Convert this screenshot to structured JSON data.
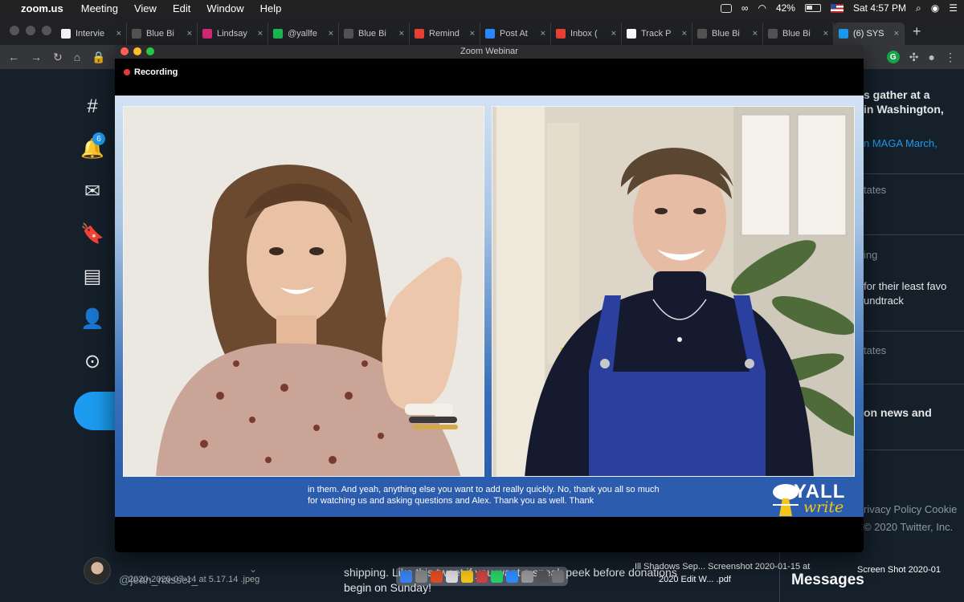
{
  "menubar": {
    "app": "zoom.us",
    "items": [
      "Meeting",
      "View",
      "Edit",
      "Window",
      "Help"
    ],
    "battery": "42%",
    "clock": "Sat 4:57 PM"
  },
  "browser": {
    "tabs": [
      {
        "label": "Intervie",
        "color": "#f2f2f2"
      },
      {
        "label": "Blue Bi",
        "color": "#555555"
      },
      {
        "label": "Lindsay",
        "color": "#d62976"
      },
      {
        "label": "@yallfe",
        "color": "#1db954"
      },
      {
        "label": "Blue Bi",
        "color": "#555555"
      },
      {
        "label": "Remind",
        "color": "#ea4335"
      },
      {
        "label": "Post At",
        "color": "#2d8cff"
      },
      {
        "label": "Inbox (",
        "color": "#ea4335"
      },
      {
        "label": "Track P",
        "color": "#ffffff"
      },
      {
        "label": "Blue Bi",
        "color": "#555555"
      },
      {
        "label": "Blue Bi",
        "color": "#555555"
      },
      {
        "label": "(6) SYS",
        "color": "#1d9bf0"
      }
    ]
  },
  "twitter": {
    "notification_count": "6",
    "right": {
      "line1": "s gather at a",
      "line2": "in Washington,",
      "line3": "n MAGA March,",
      "line4": "tates",
      "line5": "ing",
      "line6": "for their least favo",
      "line7": "undtrack",
      "line8": "tates",
      "line9": "on news and",
      "footer1": "rivacy Policy  Cookie",
      "footer2": "© 2020 Twitter, Inc."
    },
    "handle": "@jean_nasser_",
    "tweet_line1": "shipping. Like this tweet if you want a sneak peek before donations",
    "tweet_line2": "begin on Sunday!",
    "messages_title": "Messages"
  },
  "desktop": {
    "file1": "Ill Shadows Sep... Screenshot 2020-01-15 at",
    "file2": "2020 Edit W... .pdf",
    "file3": "Screen Shot 2020-01-15 at",
    "file4": "Screen Shot 2020-01",
    "file_left": "2020-2020-07-14 at 5.17.14 .jpeg"
  },
  "zoom": {
    "window_title": "Zoom Webinar",
    "recording_label": "Recording",
    "caption_line1": "in them. And yeah, anything else you want to add really quickly. No, thank you all so much",
    "caption_line2": "for watching us and asking questions and Alex. Thank you as well. Thank",
    "logo_top": "YALL",
    "logo_bottom": "write"
  }
}
